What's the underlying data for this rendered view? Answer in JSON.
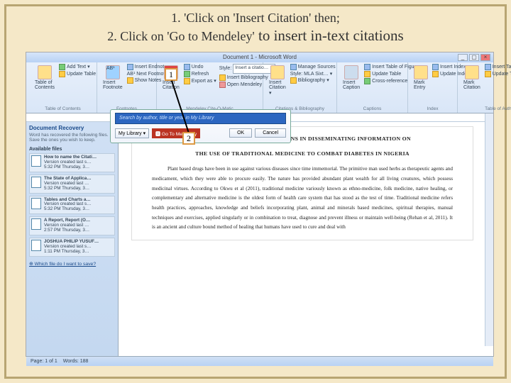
{
  "title": {
    "line1": "1. 'Click on 'Insert Citation' then;",
    "line2_a": "2. Click on 'Go to Mendeley'",
    "line2_b": " to insert in-text citations"
  },
  "window_title": "Document 1 - Microsoft Word",
  "ribbon": {
    "toc": {
      "items": [
        "Add Text ▾",
        "Update Table"
      ],
      "big": "Table of Contents",
      "label": "Table of Contents"
    },
    "footnotes": {
      "big": "Insert Footnote",
      "items": [
        "Insert Endnote",
        "AB¹ Next Footnote ▾",
        "Show Notes"
      ],
      "label": "Footnotes"
    },
    "mendeley": {
      "big": "Insert Citation",
      "items": [
        "Undo",
        "Refresh",
        "Export as ▾"
      ],
      "style_lbl": "Style:",
      "style_val": "Insert a citatio…",
      "bib": "Insert Bibliography",
      "open": "Open Mendeley",
      "label": "Mendeley Cite-O-Matic"
    },
    "citations": {
      "items": [
        "Manage Sources",
        "Style: MLA Sixt… ▾",
        "Bibliography ▾"
      ],
      "big": "Insert Citation ▾",
      "label": "Citations & Bibliography"
    },
    "captions": {
      "big": "Insert Caption",
      "items": [
        "Insert Table of Figures",
        "Update Table",
        "Cross-reference"
      ],
      "label": "Captions"
    },
    "index": {
      "big": "Mark Entry",
      "items": [
        "Insert Index",
        "Update Index"
      ],
      "label": "Index"
    },
    "toa": {
      "big": "Mark Citation",
      "items": [
        "Insert Table of Authorities",
        "Update Table"
      ],
      "label": "Table of Authorities"
    }
  },
  "sidebar": {
    "title": "Document Recovery",
    "hint": "Word has recovered the following files. Save the ones you wish to keep.",
    "avail": "Available files",
    "files": [
      {
        "name": "How to name the Citati…",
        "meta": "Version created last s…",
        "time": "5:32 PM Thursday, 3…"
      },
      {
        "name": "The State of Applica…",
        "meta": "Version created last …",
        "time": "5:32 PM Thursday, 3…"
      },
      {
        "name": "Tables and Charts a…",
        "meta": "Version created last s…",
        "time": "5:32 PM Thursday, 3…"
      },
      {
        "name": "A Report, Report (O…",
        "meta": "Version created last …",
        "time": "2:57 PM Thursday, 3…"
      },
      {
        "name": "JOSHUA PHILIP YUSUF…",
        "meta": "Version created last s…",
        "time": "1:11 PM Thursday, 3…"
      }
    ],
    "which": "⊕ Which file do I want to save?"
  },
  "popup": {
    "placeholder": "Search by author, title or year in My Library",
    "lib": "My Library ▾",
    "go": "Go To Mendeley",
    "ok": "OK",
    "cancel": "Cancel"
  },
  "doc": {
    "h1a": "THE ROLE OF HEALTH LIBRARIANS IN DISSEMINATING INFORMATION ON",
    "h1b": "THE USE OF TRADITIONAL MEDICINE TO COMBAT DIABETES IN NIGERIA",
    "para": "Plant based drugs have been in use against various diseases since time immemorial. The primitive man used herbs as therapeutic agents and medicament, which they were able to procure easily. The nature has provided abundant plant wealth for all living creatures, which possess medicinal virtues. According to Okwu et al (2011), traditional medicine variously known as ethno-medicine, folk medicine, native healing, or complementary and alternative medicine is the oldest form of health care system that has stood as the test of time. Traditional medicine refers health practices, approaches, knowledge and beliefs incorporating plant, animal and minerals based medicines, spiritual therapies, manual techniques and exercises, applied singularly or in combination to treat, diagnose and prevent illness or maintain well-being (Rehan et al, 2011). It is an ancient and culture bound method of healing that humans have used to cure and deal with"
  },
  "callouts": {
    "one": "1",
    "two": "2"
  },
  "status": {
    "page": "Page: 1 of 1",
    "words": "Words: 188"
  }
}
